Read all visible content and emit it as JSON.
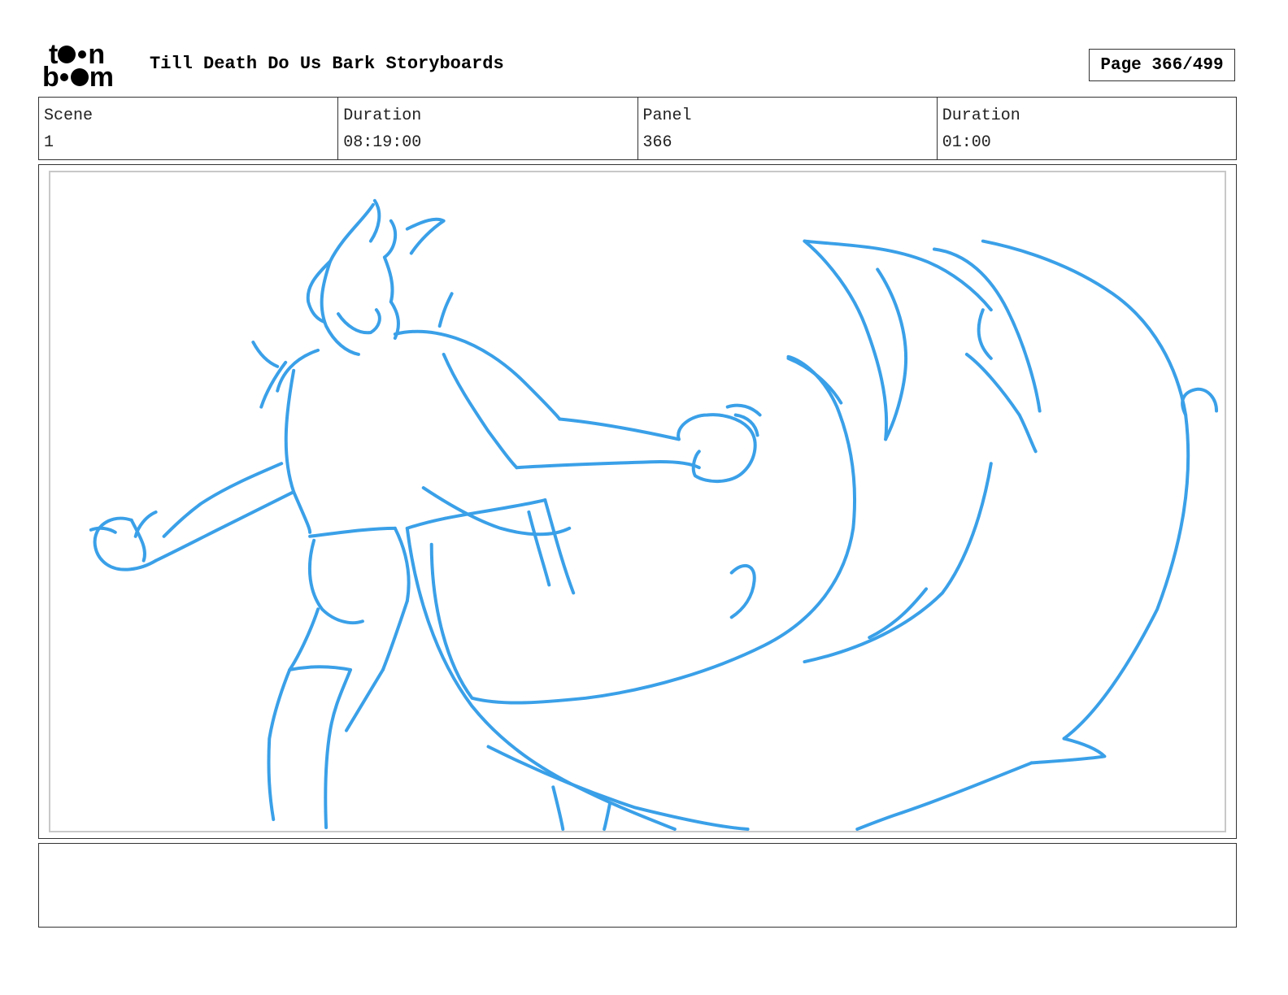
{
  "header": {
    "logo_text_top": "to",
    "logo_text_top_end": "n",
    "logo_text_bottom_start": "b",
    "logo_text_bottom_end": "m",
    "title": "Till Death Do Us Bark Storyboards",
    "page": "Page 366/499"
  },
  "info": [
    {
      "label": "Scene",
      "value": "1"
    },
    {
      "label": "Duration",
      "value": "08:19:00"
    },
    {
      "label": "Panel",
      "value": "366"
    },
    {
      "label": "Duration",
      "value": "01:00"
    }
  ],
  "sketch": {
    "stroke_color": "#3aa0e8"
  },
  "notes": ""
}
